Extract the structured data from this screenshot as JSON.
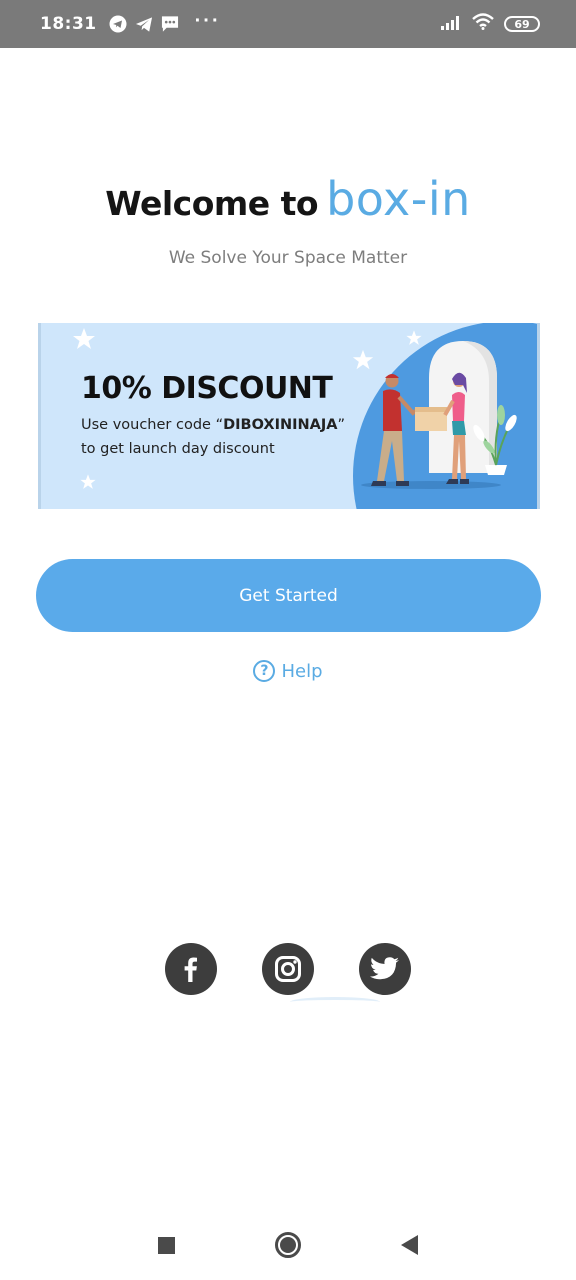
{
  "status_bar": {
    "time": "18:31",
    "battery": "69",
    "left_icons": [
      "telegram-circle-icon",
      "telegram-icon",
      "message-icon"
    ],
    "overflow": "···",
    "right_icons": [
      "signal-icon",
      "wifi-icon",
      "battery-icon"
    ]
  },
  "header": {
    "welcome": "Welcome to",
    "brand": "box-in",
    "brand_color": "#5aabe3",
    "tagline": "We Solve Your Space Matter"
  },
  "banner": {
    "title": "10% DISCOUNT",
    "line1_prefix": "Use voucher code “",
    "voucher_code": "DIBOXININAJA",
    "line1_suffix": "”",
    "line2": "to get launch day discount",
    "background": "#cfe6fb",
    "accent": "#4e9ae0"
  },
  "actions": {
    "get_started": "Get Started",
    "help": "Help",
    "button_color": "#5aaaea"
  },
  "social": [
    {
      "name": "facebook-icon"
    },
    {
      "name": "instagram-icon"
    },
    {
      "name": "twitter-icon"
    }
  ],
  "nav_bar": {
    "icons": [
      "recents-icon",
      "home-icon",
      "back-icon"
    ]
  }
}
